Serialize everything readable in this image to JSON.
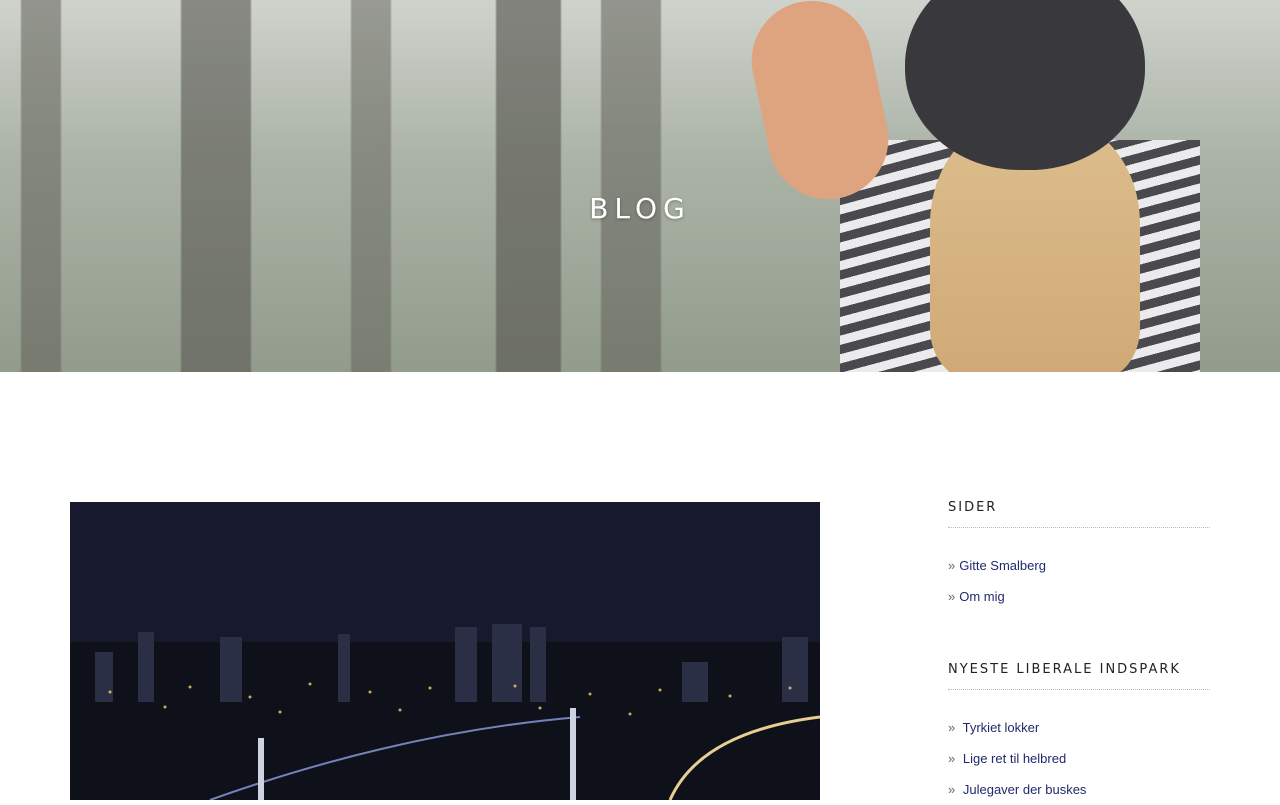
{
  "hero": {
    "title": "BLOG"
  },
  "sidebar": {
    "pages_widget": {
      "title": "SIDER",
      "items": [
        {
          "label": "Gitte Smalberg"
        },
        {
          "label": "Om mig"
        }
      ]
    },
    "recent_widget": {
      "title": "NYESTE LIBERALE INDSPARK",
      "items": [
        {
          "label": "Tyrkiet lokker"
        },
        {
          "label": "Lige ret til helbred"
        },
        {
          "label": "Julegaver der buskes"
        }
      ]
    },
    "bullet": "»"
  },
  "colors": {
    "link": "#1f2a6e",
    "hero_text": "#ffffff"
  }
}
